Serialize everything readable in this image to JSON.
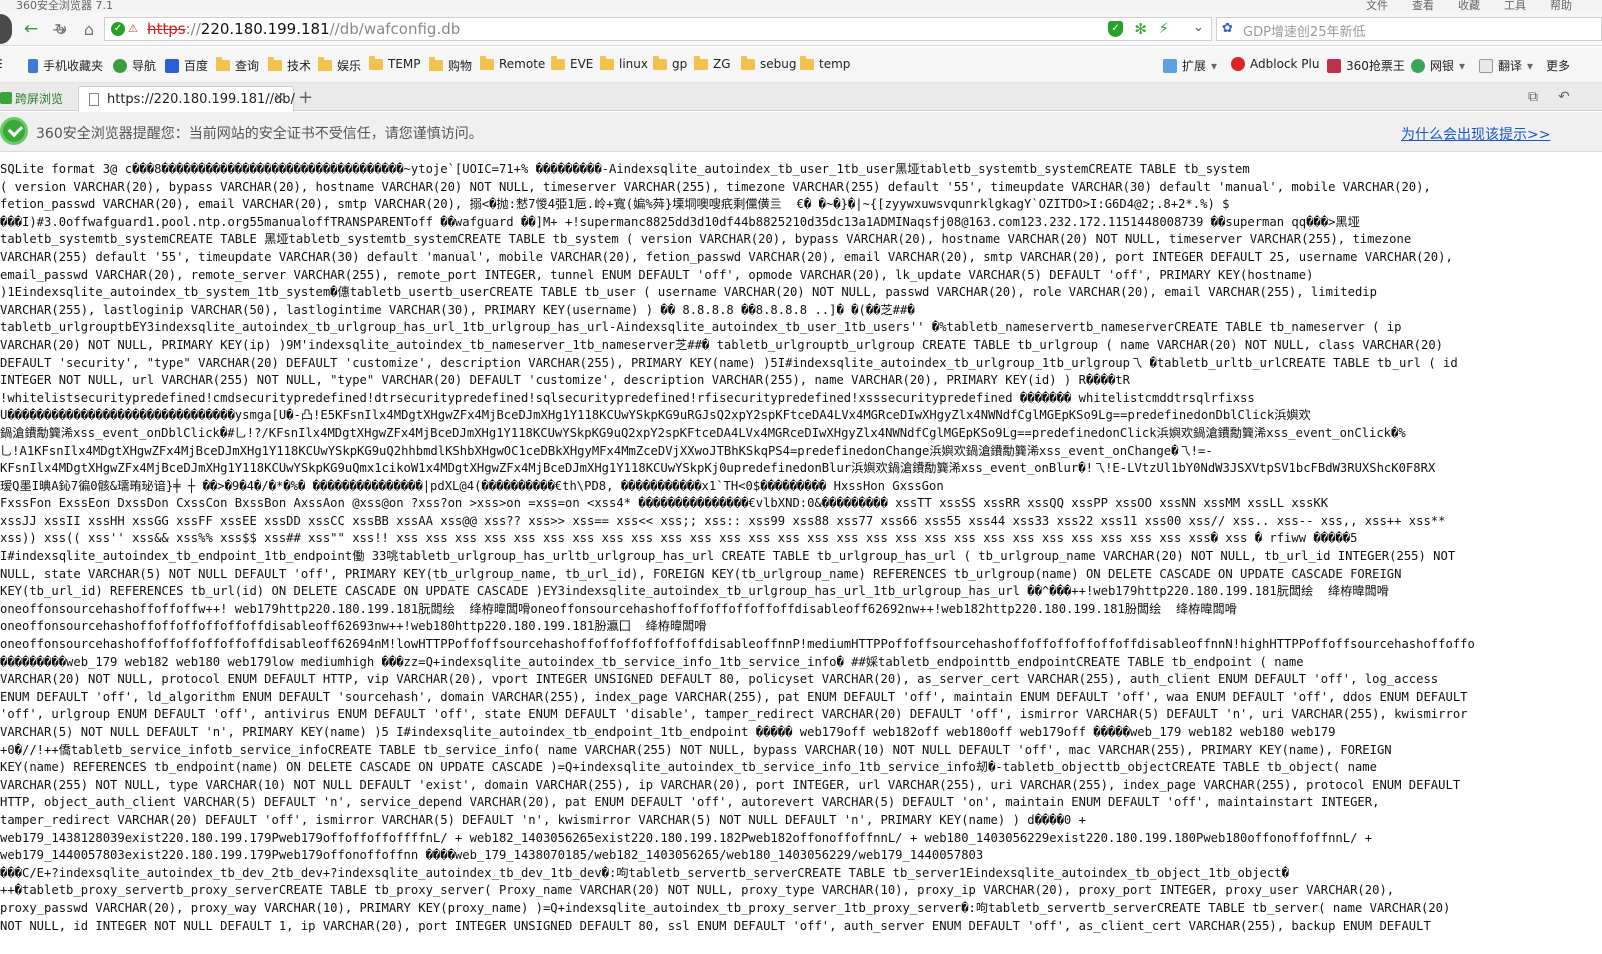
{
  "window": {
    "title": "360安全浏览器 7.1",
    "menu": [
      "文件",
      "查看",
      "收藏",
      "工具",
      "帮助"
    ]
  },
  "address_bar": {
    "url_protocol": "https",
    "url_separator": "://",
    "url_host": "220.180.199.181",
    "url_path": "//db/wafconfig.db",
    "search_placeholder": "GDP增速创25年新低"
  },
  "bookmarks": {
    "left": [
      {
        "label": "手机收藏夹",
        "icon": "phone-icon"
      },
      {
        "label": "导航",
        "icon": "compass-icon"
      },
      {
        "label": "百度",
        "icon": "baidu-icon"
      },
      {
        "label": "查询",
        "icon": "folder-icon"
      },
      {
        "label": "技术",
        "icon": "folder-icon"
      },
      {
        "label": "娱乐",
        "icon": "folder-icon"
      },
      {
        "label": "TEMP",
        "icon": "folder-icon"
      },
      {
        "label": "购物",
        "icon": "folder-icon"
      },
      {
        "label": "Remote",
        "icon": "folder-icon"
      },
      {
        "label": "EVE",
        "icon": "folder-icon"
      },
      {
        "label": "linux",
        "icon": "folder-icon"
      },
      {
        "label": "gp",
        "icon": "folder-icon"
      },
      {
        "label": "ZG",
        "icon": "folder-icon"
      },
      {
        "label": "sebug",
        "icon": "folder-icon"
      },
      {
        "label": "temp",
        "icon": "folder-icon"
      }
    ],
    "right": [
      {
        "label": "扩展",
        "icon": "grid-icon"
      },
      {
        "label": "Adblock Plu",
        "icon": "adblock-icon"
      },
      {
        "label": "360抢票王",
        "icon": "ticket-icon"
      },
      {
        "label": "网银",
        "icon": "bank-icon"
      },
      {
        "label": "翻译",
        "icon": "translate-icon"
      },
      {
        "label": "更多",
        "icon": "more-icon"
      }
    ]
  },
  "tabs": {
    "sidebar_label": "跨屏浏览",
    "active_tab_label": "https://220.180.199.181//db/",
    "new_tab": "+"
  },
  "security_warning": {
    "message": "360安全浏览器提醒您：当前网站的安全证书不受信任，请您谨慎访问。",
    "link": "为什么会出现该提示>>"
  },
  "content_lines": [
    "SQLite format 3@ c���8���������������������������������~ytoje`[UOIC=71+% ���������-Aindexsqlite_autoindex_tb_user_1tb_user黑垭tabletb_systemtb_systemCREATE TABLE tb_system",
    "( version VARCHAR(20), bypass VARCHAR(20), hostname VARCHAR(20) NOT NULL, timeserver VARCHAR(255), timezone VARCHAR(255) default '55', timeupdate VARCHAR(30) default 'manual', mobile VARCHAR(20),",
    "fetion_passwd VARCHAR(20), email VARCHAR(20), smtp VARCHAR(20), 搦<�抛:慭7惾4弫1巵.岭+寬(媥%荈}塛垌噢嗖疧剩儻僙亖  €� �~�}�|~{[zyywxuwsvqunrklgkagY`OZITDO>I:G6D4@2;.8+2*.%) $",
    "���I)#3.0offwafguard1.pool.ntp.org55manualoffTRANSPARENToff ��wafguard ��]M+ +!supermanc8825dd3d10df44b8825210d35dc13a1ADMINaqsfj08@163.com123.232.172.1151448008739 ��superman qq���>黑垭",
    "tabletb_systemtb_systemCREATE TABLE 黑垭tabletb_systemtb_systemCREATE TABLE tb_system ( version VARCHAR(20), bypass VARCHAR(20), hostname VARCHAR(20) NOT NULL, timeserver VARCHAR(255), timezone",
    "VARCHAR(255) default '55', timeupdate VARCHAR(30) default 'manual', mobile VARCHAR(20), fetion_passwd VARCHAR(20), email VARCHAR(20), smtp VARCHAR(20), port INTEGER DEFAULT 25, username VARCHAR(20),",
    "email_passwd VARCHAR(20), remote_server VARCHAR(255), remote_port INTEGER, tunnel ENUM DEFAULT 'off', opmode VARCHAR(20), lk_update VARCHAR(5) DEFAULT 'off', PRIMARY KEY(hostname)",
    ")1Eindexsqlite_autoindex_tb_system_1tb_system�僡tabletb_usertb_userCREATE TABLE tb_user ( username VARCHAR(20) NOT NULL, passwd VARCHAR(20), role VARCHAR(20), email VARCHAR(255), limitedip",
    "VARCHAR(255), lastloginip VARCHAR(50), lastlogintime VARCHAR(30), PRIMARY KEY(username) ) �� 8.8.8.8 ��8.8.8.8 ..]� �(��芝##�",
    "tabletb_urlgrouptbEY3indexsqlite_autoindex_tb_urlgroup_has_url_1tb_urlgroup_has_url-Aindexsqlite_autoindex_tb_user_1tb_users'' �%tabletb_nameservertb_nameserverCREATE TABLE tb_nameserver ( ip",
    "VARCHAR(20) NOT NULL, PRIMARY KEY(ip) )9M'indexsqlite_autoindex_tb_nameserver_1tb_nameserver芝##� tabletb_urlgrouptb_urlgroup CREATE TABLE tb_urlgroup ( name VARCHAR(20) NOT NULL, class VARCHAR(20)",
    "DEFAULT 'security', \"type\" VARCHAR(20) DEFAULT 'customize', description VARCHAR(255), PRIMARY KEY(name) )5I#indexsqlite_autoindex_tb_urlgroup_1tb_urlgroup乁 �tabletb_urltb_urlCREATE TABLE tb_url ( id",
    "INTEGER NOT NULL, url VARCHAR(255) NOT NULL, \"type\" VARCHAR(20) DEFAULT 'customize', description VARCHAR(255), name VARCHAR(20), PRIMARY KEY(id) ) R����tR",
    "!whitelistsecuritypredefined!cmdsecuritypredefined!dtrsecuritypredefined!sqlsecuritypredefined!rfisecuritypredefined!xsssecuritypredefined ������� whitelistcmddtrsqlrfixss",
    "U�������������������������������ysmga[U�-凸!E5KFsnIlx4MDgtXHgwZFx4MjBceDJmXHg1Y118KCUwYSkpKG9uRGJsQ2xpY2spKFtceDA4LVx4MGRceDIwXHgyZlx4NWNdfCglMGEpKSo9Lg==predefinedonDblClick浜嬩欢",
    "鍋滄鐨勪簨浠xss_event_onDblClick�#乚!?/KFsnIlx4MDgtXHgwZFx4MjBceDJmXHg1Y118KCUwYSkpKG9uQ2xpY2spKFtceDA4LVx4MGRceDIwXHgyZlx4NWNdfCglMGEpKSo9Lg==predefinedonClick浜嬩欢鍋滄鐨勪簨浠xss_event_onClick�%",
    "乚!A1KFsnIlx4MDgtXHgwZFx4MjBceDJmXHg1Y118KCUwYSkpKG9uQ2hhbmdlKShbXHgwOC1ceDBkXHgyMFx4MmZceDVjXXwoJTBhKSkqPS4=predefinedonChange浜嬩欢鍋滄鐨勪簨浠xss_event_onChange�乁!=-",
    "KFsnIlx4MDgtXHgwZFx4MjBceDJmXHg1Y118KCUwYSkpKG9uQmx1cikoW1x4MDgtXHgwZFx4MjBceDJmXHg1Y118KCUwYSkpKj0upredefinedonBlur浜嬩欢鍋滄鐨勪簨浠xss_event_onBlur�!乁!E-LVtzUl1bY0NdW3JSXVtpSV1bcFBdW3RUXShcK0F8RX",
    "瑷Q墨I晪A鈊7徧0骸&瓀珛珌谙}╪ ┼ ��>�9�4�/�*�%� ���������������|pdXL@4(����������€th\\PD8, �����������x1`TH<0$��������� HxssHon GxssGon",
    "FxssFon ExssEon DxssDon CxssCon BxssBon AxssAon @xss@on ?xss?on >xss>on =xss=on <xss4* ���������������€vlbXND:0&��������� xssTT xssSS xssRR xssQQ xssPP xssOO xssNN xssMM xssLL xssKK",
    "xssJJ xssII xssHH xssGG xssFF xssEE xssDD xssCC xssBB xssAA xss@@ xss?? xss>> xss== xss<< xss;; xss:: xss99 xss88 xss77 xss66 xss55 xss44 xss33 xss22 xss11 xss00 xss// xss.. xss-- xss,, xss++ xss**",
    "xss)) xss(( xss'' xss&& xss%% xss$$ xss## xss\"\" xss!! xss xss xss xss xss xss xss xss xss xss xss xss xss xss xss xss xss xss xss xss xss xss xss xss xss xss xss xss� xss � rfiww �����5",
    "I#indexsqlite_autoindex_tb_endpoint_1tb_endpoint働 33咷tabletb_urlgroup_has_urltb_urlgroup_has_url CREATE TABLE tb_urlgroup_has_url ( tb_urlgroup_name VARCHAR(20) NOT NULL, tb_url_id INTEGER(255) NOT",
    "NULL, state VARCHAR(5) NOT NULL DEFAULT 'off', PRIMARY KEY(tb_urlgroup_name, tb_url_id), FOREIGN KEY(tb_urlgroup_name) REFERENCES tb_urlgroup(name) ON DELETE CASCADE ON UPDATE CASCADE FOREIGN",
    "KEY(tb_url_id) REFERENCES tb_url(id) ON DELETE CASCADE ON UPDATE CASCADE )EY3indexsqlite_autoindex_tb_urlgroup_has_url_1tb_urlgroup_has_url ��^���++!web179http220.180.199.181朊闆绘  绛栫暐闆嗗",
    "oneoffonsourcehashoffoffoffw++! web179http220.180.199.181朊闆绘  绛栫暐闆嗗oneoffonsourcehashoffoffoffoffoffoffdisableoff62692nw++!web182http220.180.199.181朌闆绘  绛栫暐闆嗗",
    "oneoffonsourcehashoffoffoffoffoffoffdisableoff62693nw++!web180http220.180.199.181朌瀛囗  绛栫暐闆嗗",
    "oneoffonsourcehashoffoffoffoffoffoffdisableoff62694nM!lowHTTPPoffoffsourcehashoffoffoffoffoffoffdisableoffnnP!mediumHTTPPoffoffsourcehashoffoffoffoffoffoffdisableoffnnN!highHTTPPoffoffsourcehashoffoffo",
    "���������web_179 web182 web180 web179low mediumhigh ���zz=Q+indexsqlite_autoindex_tb_service_info_1tb_service_info� ##婇tabletb_endpointtb_endpointCREATE TABLE tb_endpoint ( name",
    "VARCHAR(20) NOT NULL, protocol ENUM DEFAULT HTTP, vip VARCHAR(20), vport INTEGER UNSIGNED DEFAULT 80, policyset VARCHAR(20), as_server_cert VARCHAR(255), auth_client ENUM DEFAULT 'off', log_access",
    "ENUM DEFAULT 'off', ld_algorithm ENUM DEFAULT 'sourcehash', domain VARCHAR(255), index_page VARCHAR(255), pat ENUM DEFAULT 'off', maintain ENUM DEFAULT 'off', waa ENUM DEFAULT 'off', ddos ENUM DEFAULT",
    "'off', urlgroup ENUM DEFAULT 'off', antivirus ENUM DEFAULT 'off', state ENUM DEFAULT 'disable', tamper_redirect VARCHAR(20) DEFAULT 'off', ismirror VARCHAR(5) DEFAULT 'n', uri VARCHAR(255), kwismirror",
    "VARCHAR(5) NOT NULL DEFAULT 'n', PRIMARY KEY(name) )5 I#indexsqlite_autoindex_tb_endpoint_1tb_endpoint ����� web179off web182off web180off web179off �����web_179 web182 web180 web179",
    "+0�//!++僑tabletb_service_infotb_service_infoCREATE TABLE tb_service_info( name VARCHAR(255) NOT NULL, bypass VARCHAR(10) NOT NULL DEFAULT 'off', mac VARCHAR(255), PRIMARY KEY(name), FOREIGN",
    "KEY(name) REFERENCES tb_endpoint(name) ON DELETE CASCADE ON UPDATE CASCADE )=Q+indexsqlite_autoindex_tb_service_info_1tb_service_info刼�-tabletb_objecttb_objectCREATE TABLE tb_object( name",
    "VARCHAR(255) NOT NULL, type VARCHAR(10) NOT NULL DEFAULT 'exist', domain VARCHAR(255), ip VARCHAR(20), port INTEGER, url VARCHAR(255), uri VARCHAR(255), index_page VARCHAR(255), protocol ENUM DEFAULT",
    "HTTP, object_auth_client VARCHAR(5) DEFAULT 'n', service_depend VARCHAR(20), pat ENUM DEFAULT 'off', autorevert VARCHAR(5) DEFAULT 'on', maintain ENUM DEFAULT 'off', maintainstart INTEGER,",
    "tamper_redirect VARCHAR(20) DEFAULT 'off', ismirror VARCHAR(5) DEFAULT 'n', kwismirror VARCHAR(5) NOT NULL DEFAULT 'n', PRIMARY KEY(name) ) d����0 +",
    "web179_1438128039exist220.180.199.179Pweb179offoffoffoffffnL/ + web182_1403056265exist220.180.199.182Pweb182offonoffoffnnL/ + web180_1403056229exist220.180.199.180Pweb180offonoffoffnnL/ +",
    "web179_1440057803exist220.180.199.179Pweb179offonoffoffnn ����web_179_1438070185/web182_1403056265/web180_1403056229/web179_1440057803",
    "���C/E+?indexsqlite_autoindex_tb_dev_2tb_dev+?indexsqlite_autoindex_tb_dev_1tb_dev�:呴tabletb_servertb_serverCREATE TABLE tb_server1Eindexsqlite_autoindex_tb_object_1tb_object�",
    "++�tabletb_proxy_servertb_proxy_serverCREATE TABLE tb_proxy_server( Proxy_name VARCHAR(20) NOT NULL, proxy_type VARCHAR(10), proxy_ip VARCHAR(20), proxy_port INTEGER, proxy_user VARCHAR(20),",
    "proxy_passwd VARCHAR(20), proxy_way VARCHAR(10), PRIMARY KEY(proxy_name) )=Q+indexsqlite_autoindex_tb_proxy_server_1tb_proxy_server�:呴tabletb_servertb_serverCREATE TABLE tb_server( name VARCHAR(20)",
    "NOT NULL, id INTEGER NOT NULL DEFAULT 1, ip VARCHAR(20), port INTEGER UNSIGNED DEFAULT 80, ssl ENUM DEFAULT 'off', auth_server ENUM DEFAULT 'off', as_client_cert VARCHAR(255), backup ENUM DEFAULT"
  ]
}
